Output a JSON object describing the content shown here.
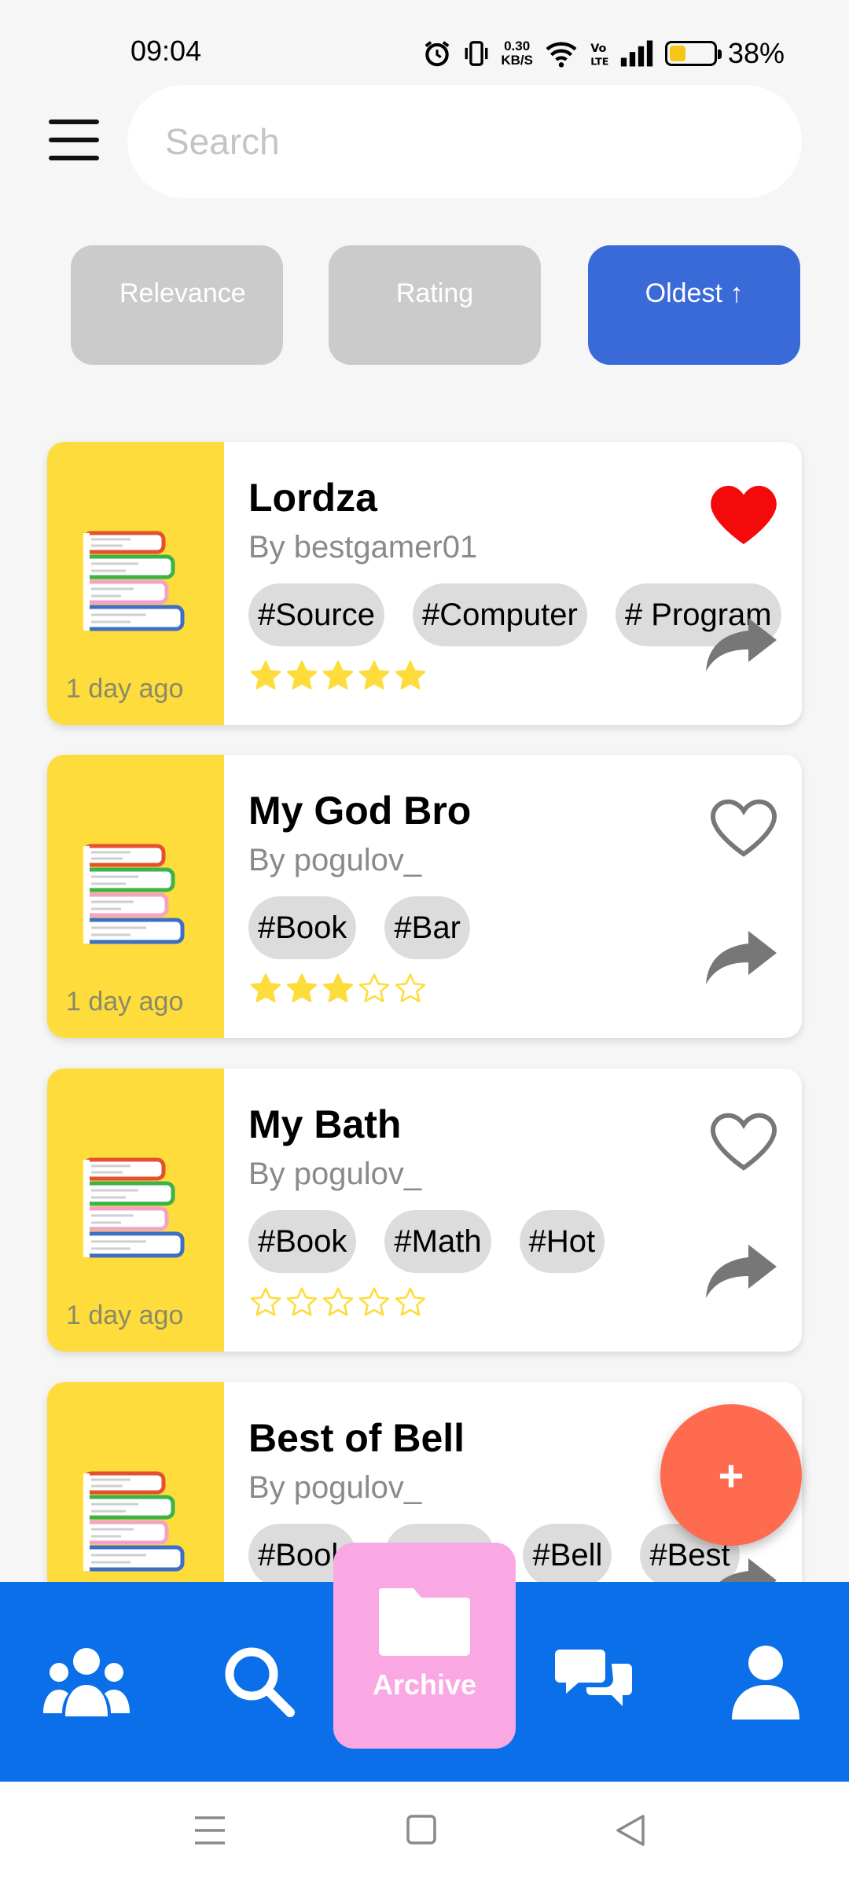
{
  "status_bar": {
    "time": "09:04",
    "net_speed_value": "0.30",
    "net_speed_unit": "KB/S",
    "battery_percent": "38%",
    "battery_level": 0.38,
    "icons": [
      "alarm-icon",
      "vibrate-icon",
      "wifi-icon",
      "volte-icon",
      "signal-icon",
      "battery-icon"
    ]
  },
  "header": {
    "menu_icon": "hamburger-menu-icon",
    "search_placeholder": "Search"
  },
  "sort_options": [
    {
      "label": "Relevance",
      "active": false
    },
    {
      "label": "Rating",
      "active": false
    },
    {
      "label": "Oldest ↑",
      "active": true
    }
  ],
  "cards": [
    {
      "title": "Lordza",
      "author": "By bestgamer01",
      "tags": [
        "#Source",
        "#Computer",
        "# Program"
      ],
      "rating": 5,
      "liked": true,
      "date": "1 day ago"
    },
    {
      "title": "My God Bro",
      "author": "By pogulov_",
      "tags": [
        "#Book",
        "#Bar"
      ],
      "rating": 3,
      "liked": false,
      "date": "1 day ago"
    },
    {
      "title": "My Bath",
      "author": "By pogulov_",
      "tags": [
        "#Book",
        "#Math",
        "#Hot"
      ],
      "rating": 0,
      "liked": false,
      "date": "1 day ago"
    },
    {
      "title": "Best of Bell",
      "author": "By pogulov_",
      "tags": [
        "#Book",
        "",
        "#Bell",
        "#Best"
      ],
      "rating": 0,
      "liked": false,
      "date": ""
    }
  ],
  "fab": {
    "label": "+"
  },
  "bottom_nav": {
    "items": [
      {
        "icon": "community-icon"
      },
      {
        "icon": "search-icon"
      },
      {
        "icon": "folder-icon",
        "label": "Archive",
        "active": true
      },
      {
        "icon": "chat-icon"
      },
      {
        "icon": "profile-icon"
      }
    ]
  },
  "colors": {
    "accent": "#3a69d8",
    "nav_bar": "#0a6fe8",
    "archive_active": "#f9a8e3",
    "card_side": "#fddc3b",
    "fab": "#fe6b4e",
    "heart_liked": "#f40a0a",
    "star": "#fddc3b"
  }
}
